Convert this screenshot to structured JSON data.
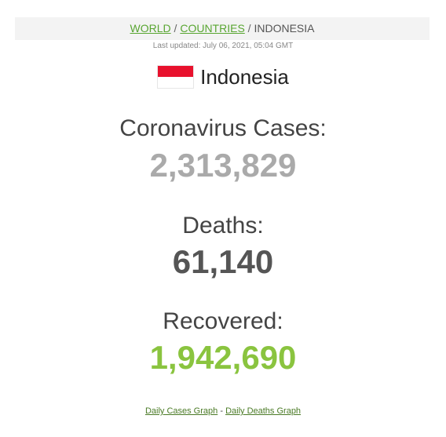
{
  "breadcrumb": {
    "world": "WORLD",
    "countries": "COUNTRIES",
    "current": "INDONESIA",
    "separator": "/"
  },
  "last_updated": "Last updated: July 06, 2021, 05:04 GMT",
  "country": {
    "name": "Indonesia",
    "flag_colors": {
      "top": "#e8112d",
      "bottom": "#ffffff"
    }
  },
  "stats": {
    "cases": {
      "label": "Coronavirus Cases:",
      "value": "2,313,829",
      "color": "#aaaaaa"
    },
    "deaths": {
      "label": "Deaths:",
      "value": "61,140",
      "color": "#555555"
    },
    "recovered": {
      "label": "Recovered:",
      "value": "1,942,690",
      "color": "#8ac43f"
    }
  },
  "footer": {
    "cases_graph": "Daily Cases Graph",
    "separator": "-",
    "deaths_graph": "Daily Deaths Graph"
  },
  "colors": {
    "link": "#59a632",
    "breadcrumb_bg": "#f3f3f3"
  }
}
